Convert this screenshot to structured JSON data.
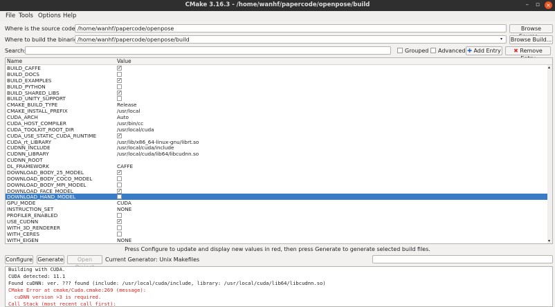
{
  "window": {
    "title": "CMake 3.16.3 - /home/wanhf/papercode/openpose/build",
    "minimize": "–",
    "maximize": "▫",
    "close": "×"
  },
  "menu": [
    "File",
    "Tools",
    "Options",
    "Help"
  ],
  "source": {
    "label": "Where is the source code:",
    "value": "/home/wanhf/papercode/openpose",
    "button": "Browse Source..."
  },
  "build": {
    "label": "Where to build the binaries:",
    "value": "/home/wanhf/papercode/openpose/build",
    "button": "Browse Build..."
  },
  "search": {
    "label": "Search:",
    "value": "",
    "grouped": "Grouped",
    "advanced": "Advanced",
    "add_entry": "Add Entry",
    "remove_entry": "Remove Entry"
  },
  "table": {
    "headers": [
      "Name",
      "Value"
    ],
    "rows": [
      {
        "name": "BUILD_CAFFE",
        "type": "bool",
        "value": true
      },
      {
        "name": "BUILD_DOCS",
        "type": "bool",
        "value": false
      },
      {
        "name": "BUILD_EXAMPLES",
        "type": "bool",
        "value": true
      },
      {
        "name": "BUILD_PYTHON",
        "type": "bool",
        "value": false
      },
      {
        "name": "BUILD_SHARED_LIBS",
        "type": "bool",
        "value": true
      },
      {
        "name": "BUILD_UNITY_SUPPORT",
        "type": "bool",
        "value": false
      },
      {
        "name": "CMAKE_BUILD_TYPE",
        "type": "text",
        "value": "Release"
      },
      {
        "name": "CMAKE_INSTALL_PREFIX",
        "type": "text",
        "value": "/usr/local"
      },
      {
        "name": "CUDA_ARCH",
        "type": "text",
        "value": "Auto"
      },
      {
        "name": "CUDA_HOST_COMPILER",
        "type": "text",
        "value": "/usr/bin/cc"
      },
      {
        "name": "CUDA_TOOLKIT_ROOT_DIR",
        "type": "text",
        "value": "/usr/local/cuda"
      },
      {
        "name": "CUDA_USE_STATIC_CUDA_RUNTIME",
        "type": "bool",
        "value": true
      },
      {
        "name": "CUDA_rt_LIBRARY",
        "type": "text",
        "value": "/usr/lib/x86_64-linux-gnu/librt.so"
      },
      {
        "name": "CUDNN_INCLUDE",
        "type": "text",
        "value": "/usr/local/cuda/include"
      },
      {
        "name": "CUDNN_LIBRARY",
        "type": "text",
        "value": "/usr/local/cuda/lib64/libcudnn.so"
      },
      {
        "name": "CUDNN_ROOT",
        "type": "text",
        "value": ""
      },
      {
        "name": "DL_FRAMEWORK",
        "type": "text",
        "value": "CAFFE"
      },
      {
        "name": "DOWNLOAD_BODY_25_MODEL",
        "type": "bool",
        "value": true
      },
      {
        "name": "DOWNLOAD_BODY_COCO_MODEL",
        "type": "bool",
        "value": false
      },
      {
        "name": "DOWNLOAD_BODY_MPI_MODEL",
        "type": "bool",
        "value": false
      },
      {
        "name": "DOWNLOAD_FACE_MODEL",
        "type": "bool",
        "value": true
      },
      {
        "name": "DOWNLOAD_HAND_MODEL",
        "type": "bool",
        "value": false,
        "selected": true
      },
      {
        "name": "GPU_MODE",
        "type": "text",
        "value": "CUDA"
      },
      {
        "name": "INSTRUCTION_SET",
        "type": "text",
        "value": "NONE"
      },
      {
        "name": "PROFILER_ENABLED",
        "type": "bool",
        "value": false
      },
      {
        "name": "USE_CUDNN",
        "type": "bool",
        "value": true
      },
      {
        "name": "WITH_3D_RENDERER",
        "type": "bool",
        "value": false
      },
      {
        "name": "WITH_CERES",
        "type": "bool",
        "value": false
      },
      {
        "name": "WITH_EIGEN",
        "type": "text",
        "value": "NONE"
      }
    ]
  },
  "status_text": "Press Configure to update and display new values in red, then press Generate to generate selected build files.",
  "actions": {
    "configure": "Configure",
    "generate": "Generate",
    "open_project": "Open Project",
    "current_generator": "Current Generator: Unix Makefiles"
  },
  "log": [
    {
      "text": "Building with CUDA.",
      "error": false
    },
    {
      "text": "CUDA detected: 11.1",
      "error": false
    },
    {
      "text": "Found cuDNN: ver. ??? found (include: /usr/local/cuda/include, library: /usr/local/cuda/lib64/libcudnn.so)",
      "error": false
    },
    {
      "text": "CMake Error at cmake/Cuda.cmake:269 (message):",
      "error": true
    },
    {
      "text": "  cuDNN version >3 is required.",
      "error": true
    },
    {
      "text": "Call Stack (most recent call first):",
      "error": true
    }
  ]
}
